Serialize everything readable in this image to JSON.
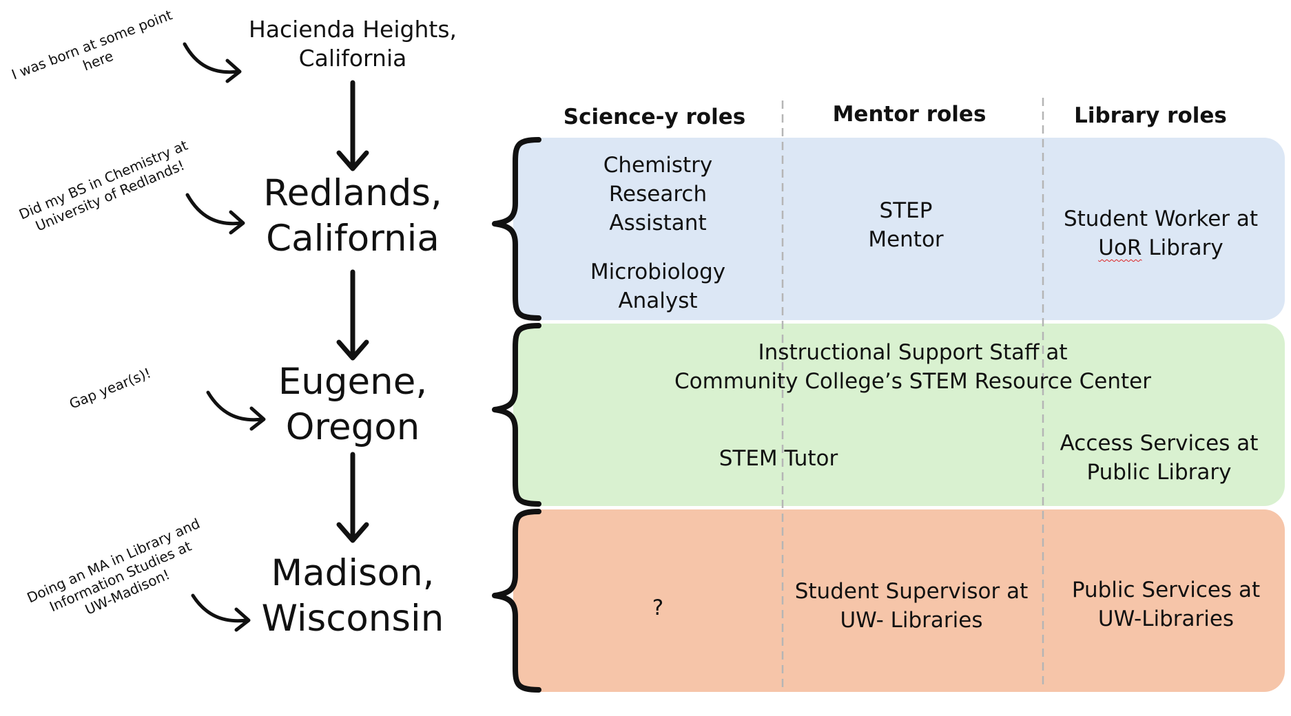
{
  "locations": [
    {
      "id": "hacienda",
      "line1": "Hacienda Heights,",
      "line2": "California"
    },
    {
      "id": "redlands",
      "line1": "Redlands,",
      "line2": "California"
    },
    {
      "id": "eugene",
      "line1": "Eugene,",
      "line2": "Oregon"
    },
    {
      "id": "madison",
      "line1": "Madison,",
      "line2": "Wisconsin"
    }
  ],
  "notes": {
    "born": {
      "line1": "I was born at some point",
      "line2": "here"
    },
    "bs": {
      "line1": "Did my BS in Chemistry at",
      "line2": "University of Redlands!"
    },
    "gap": {
      "line1": "Gap year(s)!"
    },
    "ma": {
      "line1": "Doing an MA in Library and",
      "line2": "Information Studies at",
      "line3": "UW-Madison!"
    }
  },
  "columns": {
    "science": "Science-y roles",
    "mentor": "Mentor roles",
    "library": "Library roles"
  },
  "colors": {
    "redlands_band": "#dce7f5",
    "eugene_band": "#d9f1d0",
    "madison_band": "#f6c5a9",
    "divider": "#b5b5b5"
  },
  "redlands": {
    "science_1": {
      "line1": "Chemistry",
      "line2": "Research",
      "line3": "Assistant"
    },
    "science_2": {
      "line1": "Microbiology",
      "line2": "Analyst"
    },
    "mentor": {
      "line1": "STEP",
      "line2": "Mentor"
    },
    "library": {
      "line1": "Student Worker at",
      "line2_prefix": "",
      "line2_underlined": "UoR",
      "line2_suffix": " Library"
    }
  },
  "eugene": {
    "span": {
      "line1": "Instructional Support Staff at",
      "line2": "Community College’s STEM Resource Center"
    },
    "tutor": "STEM Tutor",
    "library": {
      "line1": "Access Services at",
      "line2": "Public Library"
    }
  },
  "madison": {
    "science": "?",
    "mentor": {
      "line1": "Student Supervisor at",
      "line2": "UW- Libraries"
    },
    "library": {
      "line1": "Public Services at",
      "line2": "UW-Libraries"
    }
  }
}
